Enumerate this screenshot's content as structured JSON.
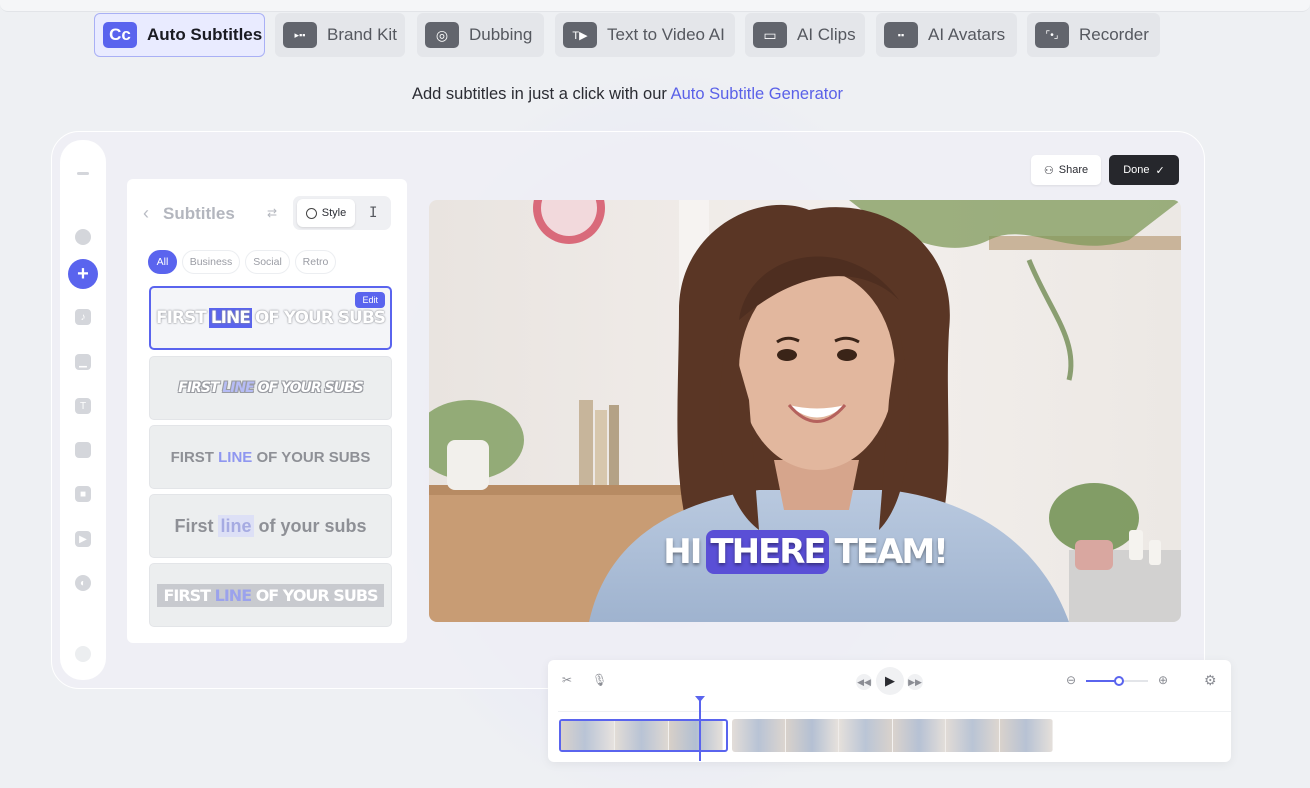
{
  "tabs": [
    {
      "label": "Auto Subtitles",
      "icon": "cc-icon",
      "glyph": "Cc",
      "active": true
    },
    {
      "label": "Brand Kit",
      "icon": "brand-kit-icon",
      "glyph": "▸▪▪",
      "active": false
    },
    {
      "label": "Dubbing",
      "icon": "globe-icon",
      "glyph": "◎",
      "active": false
    },
    {
      "label": "Text to Video AI",
      "icon": "text-to-video-icon",
      "glyph": "T▶",
      "active": false
    },
    {
      "label": "AI Clips",
      "icon": "clips-icon",
      "glyph": "▭",
      "active": false
    },
    {
      "label": "AI Avatars",
      "icon": "avatar-icon",
      "glyph": "▪▪",
      "active": false
    },
    {
      "label": "Recorder",
      "icon": "recorder-icon",
      "glyph": "⌜•⌟",
      "active": false
    }
  ],
  "headline": {
    "text": "Add subtitles in just a click with our",
    "link": "Auto Subtitle Generator"
  },
  "panel": {
    "title": "Subtitles",
    "style_label": "Style",
    "filters": [
      "All",
      "Business",
      "Social",
      "Retro"
    ],
    "active_filter": "All",
    "edit_label": "Edit",
    "presets": [
      {
        "before": "FIRST",
        "highlight": "LINE",
        "after": "OF YOUR SUBS"
      },
      {
        "before": "FIRST",
        "highlight": "LINE",
        "after": "OF YOUR SUBS"
      },
      {
        "before": "FIRST",
        "highlight": "LINE",
        "after": "OF YOUR SUBS"
      },
      {
        "before": "First",
        "highlight": "line",
        "after": "of your subs"
      },
      {
        "before": "FIRST",
        "highlight": "LINE",
        "after": "OF YOUR SUBS"
      }
    ]
  },
  "header_actions": {
    "share_label": "Share",
    "done_label": "Done"
  },
  "video": {
    "caption_before": "HI",
    "caption_highlight": "THERE",
    "caption_after": "TEAM!"
  },
  "colors": {
    "accent": "#5a64ee",
    "done_bg": "#26272c"
  }
}
